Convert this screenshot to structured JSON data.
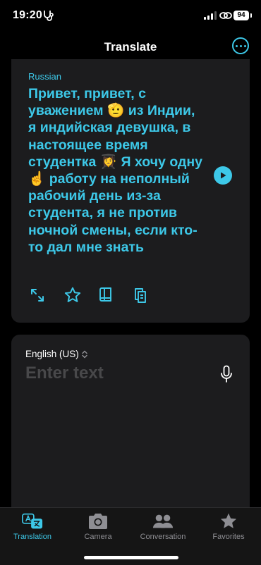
{
  "status_bar": {
    "time": "19:20",
    "battery": "94",
    "extra_icon": "stethoscope-icon",
    "icons": [
      "signal-icon",
      "link-icon",
      "battery-icon"
    ]
  },
  "header": {
    "title": "Translate",
    "more_icon": "ellipsis-circle-icon"
  },
  "colors": {
    "accent": "#3dc8e8",
    "background": "#000000",
    "card": "#1c1c1e",
    "placeholder": "#48484a",
    "inactive": "#8e8e93"
  },
  "translation_card": {
    "language": "Russian",
    "text": "Привет, привет, с уважением 🫡 из Индии, я индийская девушка, в настоящее время студентка 👩‍🎓 Я хочу одну ☝️ работу на неполный рабочий день из-за студента, я не против ночной смены, если кто-то дал мне знать",
    "play_icon": "play-icon",
    "actions": [
      {
        "name": "expand",
        "icon": "expand-arrows-icon"
      },
      {
        "name": "favorite",
        "icon": "star-icon"
      },
      {
        "name": "dictionary",
        "icon": "book-icon"
      },
      {
        "name": "copy",
        "icon": "copy-icon"
      }
    ]
  },
  "input_card": {
    "language": "English (US)",
    "placeholder": "Enter text",
    "value": "",
    "mic_icon": "microphone-icon"
  },
  "tabs": [
    {
      "label": "Translation",
      "icon": "translate-icon",
      "active": true
    },
    {
      "label": "Camera",
      "icon": "camera-icon",
      "active": false
    },
    {
      "label": "Conversation",
      "icon": "people-icon",
      "active": false
    },
    {
      "label": "Favorites",
      "icon": "star-icon",
      "active": false
    }
  ]
}
